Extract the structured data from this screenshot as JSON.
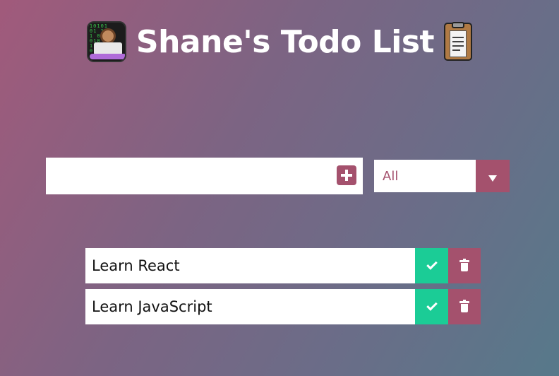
{
  "header": {
    "title": "Shane's Todo List",
    "left_icon": "technologist-emoji-icon",
    "right_icon": "clipboard-emoji-icon"
  },
  "form": {
    "input_value": "",
    "input_placeholder": "",
    "add_icon": "plus-square-icon",
    "filter": {
      "selected": "All",
      "arrow_icon": "caret-down-icon"
    }
  },
  "todos": [
    {
      "text": "Learn React",
      "complete_icon": "check-icon",
      "delete_icon": "trash-icon"
    },
    {
      "text": "Learn JavaScript",
      "complete_icon": "check-icon",
      "delete_icon": "trash-icon"
    }
  ],
  "colors": {
    "accent": "#a4516d",
    "complete": "#1bcc96",
    "text_light": "#ffffff"
  }
}
